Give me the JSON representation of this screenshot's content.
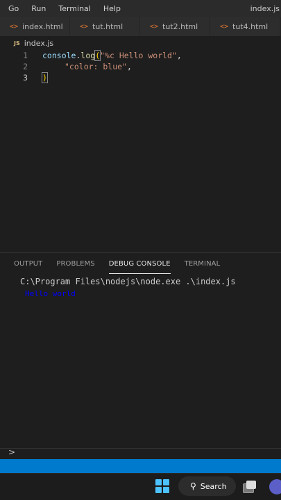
{
  "menubar": {
    "items": [
      "Go",
      "Run",
      "Terminal",
      "Help"
    ],
    "window_title": "index.js"
  },
  "tabs": [
    {
      "label": "index.html",
      "icon": "html-file-icon"
    },
    {
      "label": "tut.html",
      "icon": "html-file-icon"
    },
    {
      "label": "tut2.html",
      "icon": "html-file-icon"
    },
    {
      "label": "tut4.html",
      "icon": "html-file-icon"
    }
  ],
  "breadcrumb": {
    "icon_text": "JS",
    "file": "index.js"
  },
  "editor": {
    "lines": [
      {
        "num": "1",
        "fn": "console",
        "dot": ".",
        "method": "log",
        "open": "(",
        "str": "\"%c Hello world\"",
        "end": ","
      },
      {
        "num": "2",
        "str": "\"color: blue\"",
        "end": ","
      },
      {
        "num": "3",
        "close": ")"
      }
    ]
  },
  "panel": {
    "tabs": [
      "OUTPUT",
      "PROBLEMS",
      "DEBUG CONSOLE",
      "TERMINAL"
    ],
    "active_tab": "DEBUG CONSOLE",
    "console_command": "C:\\Program Files\\nodejs\\node.exe .\\index.js",
    "console_output": "Hello world",
    "output_color": "#0000ff",
    "prompt": ">"
  },
  "taskbar": {
    "search_label": "Search",
    "accent": "#4cc2ff"
  },
  "colors": {
    "statusbar": "#007acc",
    "string": "#ce9178",
    "bracket": "#ffd700"
  }
}
